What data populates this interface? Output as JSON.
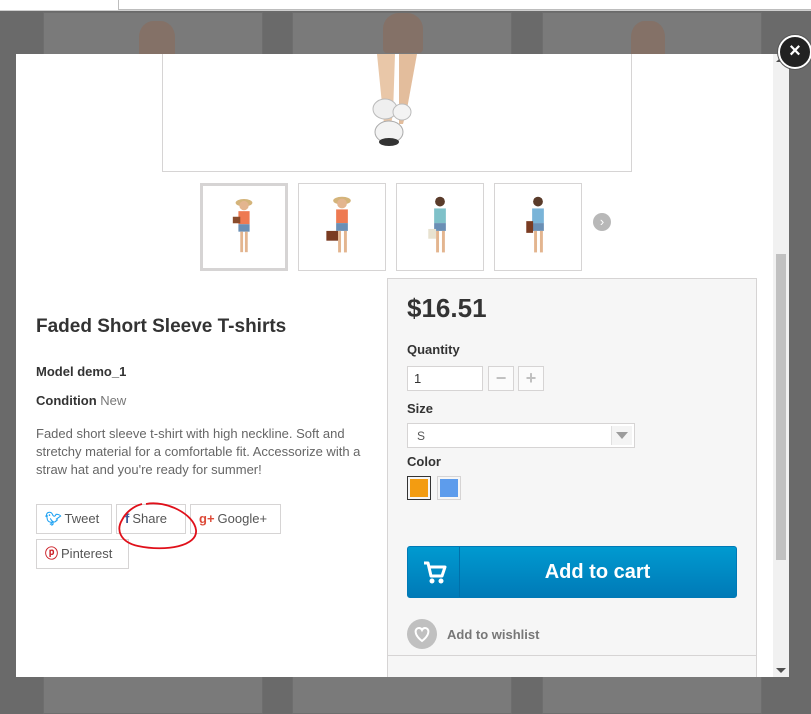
{
  "product": {
    "title": "Faded Short Sleeve T-shirts",
    "model_label": "Model",
    "model_value": "demo_1",
    "condition_label": "Condition",
    "condition_value": "New",
    "description": "Faded short sleeve t-shirt with high neckline. Soft and stretchy material for a comfortable fit. Accessorize with a straw hat and you're ready for summer!"
  },
  "social": {
    "tweet": "Tweet",
    "share": "Share",
    "googleplus": "Google+",
    "pinterest": "Pinterest"
  },
  "buy_box": {
    "price": "$16.51",
    "quantity_label": "Quantity",
    "quantity_value": "1",
    "minus": "−",
    "plus": "+",
    "size_label": "Size",
    "size_value": "S",
    "color_label": "Color",
    "colors": [
      "#f39c11",
      "#5d9cec"
    ],
    "add_to_cart": "Add to cart",
    "add_to_wishlist": "Add to wishlist"
  },
  "close_symbol": "×",
  "next_arrow": "›",
  "icons": {
    "twitter": "twitter-icon",
    "facebook": "facebook-icon",
    "googleplus": "google-plus-icon",
    "pinterest": "pinterest-icon",
    "cart": "cart-icon",
    "heart": "heart-icon"
  }
}
